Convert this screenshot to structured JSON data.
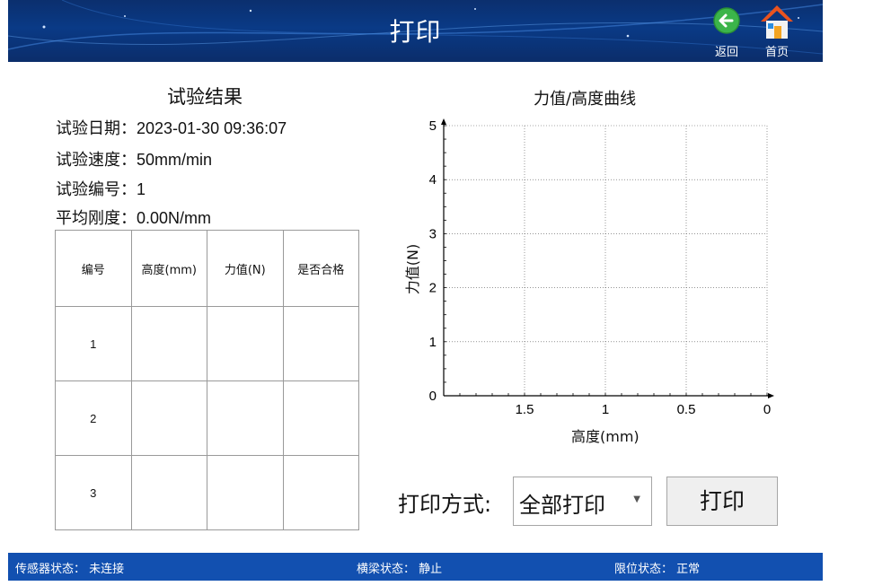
{
  "header": {
    "title": "打印",
    "back_label": "返回",
    "home_label": "首页"
  },
  "results": {
    "title": "试验结果",
    "fields": [
      {
        "label": "试验日期：",
        "value": "2023-01-30 09:36:07"
      },
      {
        "label": "试验速度：",
        "value": "50mm/min"
      },
      {
        "label": "试验编号：",
        "value": "1"
      },
      {
        "label": "平均刚度：",
        "value": "0.00N/mm"
      }
    ],
    "table": {
      "columns": [
        "编号",
        "高度(mm)",
        "力值(N)",
        "是否合格"
      ],
      "rows": [
        [
          "1",
          "",
          "",
          ""
        ],
        [
          "2",
          "",
          "",
          ""
        ],
        [
          "3",
          "",
          "",
          ""
        ]
      ]
    }
  },
  "chart_data": {
    "type": "line",
    "title": "力值/高度曲线",
    "xlabel": "高度(mm)",
    "ylabel": "力值(N)",
    "x_ticks": [
      "1.5",
      "1",
      "0.5",
      "0"
    ],
    "y_ticks": [
      "0",
      "1",
      "2",
      "3",
      "4",
      "5"
    ],
    "xlim": [
      2,
      0
    ],
    "ylim": [
      0,
      5
    ],
    "grid": true,
    "series": []
  },
  "print_controls": {
    "mode_label": "打印方式:",
    "mode_value": "全部打印",
    "print_button": "打印"
  },
  "status_bar": {
    "sensor": "传感器状态：  未连接",
    "beam": "横梁状态：  静止",
    "limit": "限位状态：  正常"
  },
  "colors": {
    "header_bg": "#0a3a86",
    "status_bg": "#1250b0",
    "back_icon": "#3bb54a",
    "home_roof": "#e8531f"
  }
}
